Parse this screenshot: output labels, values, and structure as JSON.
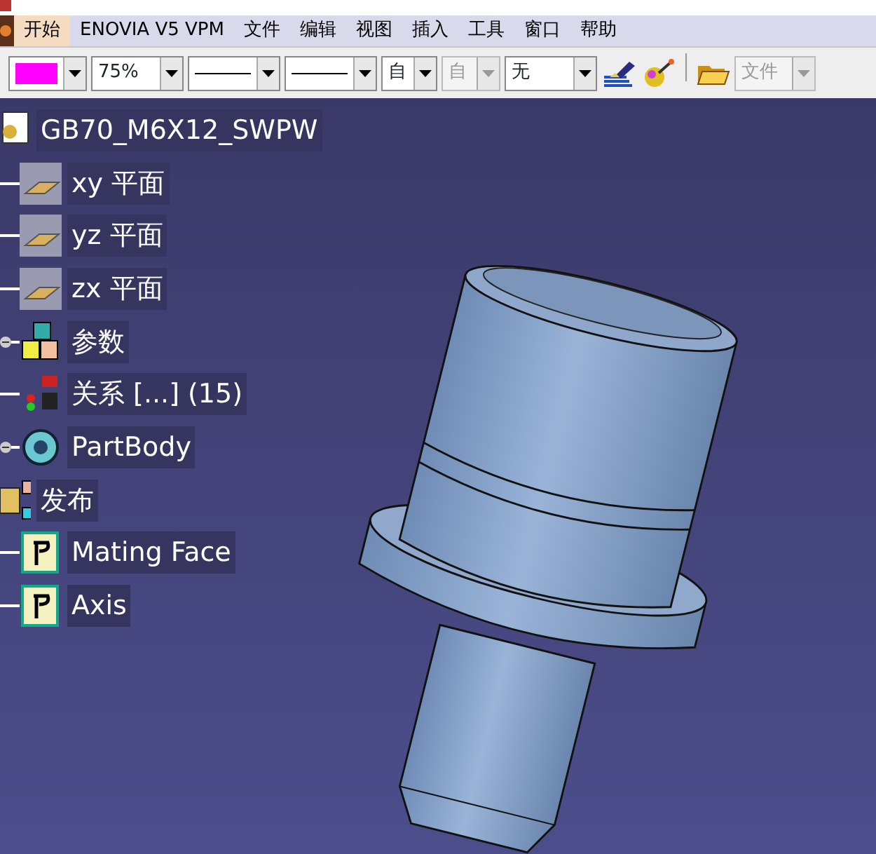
{
  "menu": [
    {
      "label": "开始",
      "selected": true
    },
    {
      "label": "ENOVIA V5 VPM",
      "selected": false
    },
    {
      "label": "文件",
      "selected": false
    },
    {
      "label": "编辑",
      "selected": false
    },
    {
      "label": "视图",
      "selected": false
    },
    {
      "label": "插入",
      "selected": false
    },
    {
      "label": "工具",
      "selected": false
    },
    {
      "label": "窗口",
      "selected": false
    },
    {
      "label": "帮助",
      "selected": false
    }
  ],
  "toolbar": [
    {
      "kind": "color",
      "color": "#ff00ff",
      "disabled": false
    },
    {
      "kind": "combo",
      "value": "75%",
      "disabled": false
    },
    {
      "kind": "line",
      "disabled": false
    },
    {
      "kind": "line",
      "disabled": false
    },
    {
      "kind": "combo",
      "value": "自",
      "disabled": false
    },
    {
      "kind": "combo",
      "value": "自",
      "disabled": true
    },
    {
      "kind": "combo",
      "value": "无",
      "disabled": false
    },
    {
      "kind": "brush"
    },
    {
      "kind": "wand"
    },
    {
      "kind": "separator"
    },
    {
      "kind": "folder"
    },
    {
      "kind": "combo",
      "value": "文件",
      "disabled": true
    }
  ],
  "tree": [
    {
      "label": "GB70_M6X12_SWPW",
      "kind": "part",
      "collapsible": false,
      "children": [
        {
          "label": "xy 平面",
          "kind": "plane",
          "collapsible": false
        },
        {
          "label": "yz 平面",
          "kind": "plane",
          "collapsible": false
        },
        {
          "label": "zx 平面",
          "kind": "plane",
          "collapsible": false
        },
        {
          "label": "参数",
          "kind": "parameters",
          "collapsible": true
        },
        {
          "label": "关系 [...] (15)",
          "kind": "relations",
          "collapsible": false
        },
        {
          "label": "PartBody",
          "kind": "body",
          "collapsible": true
        }
      ]
    },
    {
      "label": "发布",
      "kind": "publication",
      "collapsible": false,
      "children": [
        {
          "label": "Mating Face",
          "kind": "published",
          "collapsible": false
        },
        {
          "label": "Axis",
          "kind": "published",
          "collapsible": false
        }
      ]
    }
  ]
}
